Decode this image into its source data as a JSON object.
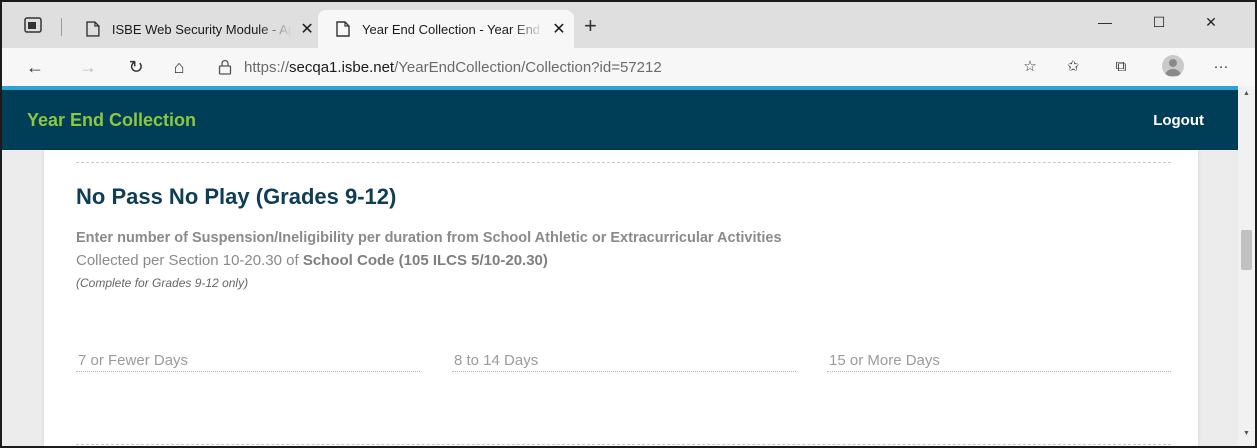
{
  "browser": {
    "tabs": [
      {
        "title": "ISBE Web Security Module - Application",
        "close": "✕"
      },
      {
        "title": "Year End Collection - Year End Collection",
        "close": "✕"
      }
    ],
    "new_tab": "+",
    "window_controls": {
      "minimize": "—",
      "maximize": "☐",
      "close": "✕"
    },
    "url": {
      "scheme": "https://",
      "host": "secqa1.isbe.net",
      "path": "/YearEndCollection/Collection?id=57212"
    },
    "nav": {
      "back": "←",
      "forward": "→",
      "refresh": "↻",
      "home": "⌂"
    },
    "tools": {
      "favorite": "☆",
      "favorites": "✩",
      "collections": "⧉",
      "more": "···"
    }
  },
  "app": {
    "title": "Year End Collection",
    "logout": "Logout"
  },
  "section": {
    "title": "No Pass No Play (Grades 9-12)",
    "instruction": "Enter number of Suspension/Ineligibility per duration from School Athletic or Extracurricular Activities",
    "collected_prefix": "Collected per Section 10-20.30 of ",
    "collected_code": "School Code (105 ILCS 5/10-20.30)",
    "note": "(Complete for Grades 9-12 only)",
    "fields": [
      {
        "placeholder": "7 or Fewer Days"
      },
      {
        "placeholder": "8 to 14 Days"
      },
      {
        "placeholder": "15 or More Days"
      }
    ]
  },
  "scrollbar": {
    "up": "▲",
    "down": "▼"
  }
}
